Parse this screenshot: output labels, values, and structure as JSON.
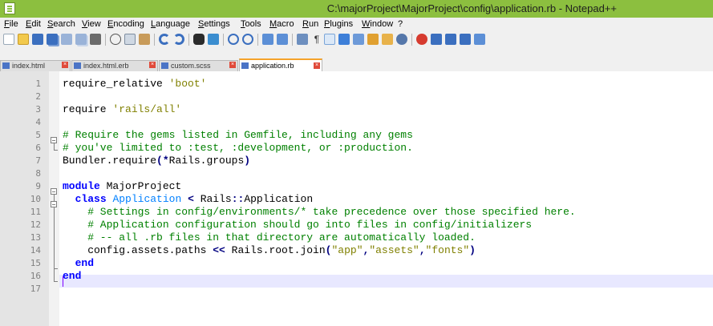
{
  "window": {
    "title": "C:\\majorProject\\MajorProject\\config\\application.rb - Notepad++"
  },
  "menu": [
    "File",
    "Edit",
    "Search",
    "View",
    "Encoding",
    "Language",
    "Settings",
    "Tools",
    "Macro",
    "Run",
    "Plugins",
    "Window",
    "?"
  ],
  "toolbar_icons": [
    "new-file-icon",
    "open-file-icon",
    "save-icon",
    "save-all-icon",
    "close-icon",
    "close-all-icon",
    "print-icon",
    "cut-icon",
    "copy-icon",
    "paste-icon",
    "undo-icon",
    "redo-icon",
    "find-icon",
    "replace-icon",
    "zoom-in-icon",
    "zoom-out-icon",
    "sync-vertical-icon",
    "sync-horizontal-icon",
    "word-wrap-icon",
    "show-all-chars-icon",
    "indent-guide-icon",
    "user-language-icon",
    "doc-map-icon",
    "function-list-icon",
    "folder-workspace-icon",
    "monitor-icon",
    "record-macro-icon",
    "stop-record-icon",
    "play-macro-icon",
    "run-macro-multiple-icon",
    "save-macro-icon"
  ],
  "tabs": [
    {
      "label": "index.html",
      "active": false
    },
    {
      "label": "index.html.erb",
      "active": false
    },
    {
      "label": "custom.scss",
      "active": false
    },
    {
      "label": "application.rb",
      "active": true
    }
  ],
  "editor": {
    "lines": [
      {
        "n": "1",
        "tokens": [
          {
            "t": "require_relative ",
            "c": ""
          },
          {
            "t": "'boot'",
            "c": "str"
          }
        ]
      },
      {
        "n": "2",
        "tokens": []
      },
      {
        "n": "3",
        "tokens": [
          {
            "t": "require ",
            "c": ""
          },
          {
            "t": "'rails/all'",
            "c": "str"
          }
        ]
      },
      {
        "n": "4",
        "tokens": []
      },
      {
        "n": "5",
        "tokens": [
          {
            "t": "# Require the gems listed in Gemfile, including any gems",
            "c": "cm"
          }
        ]
      },
      {
        "n": "6",
        "tokens": [
          {
            "t": "# you've limited to :test, :development, or :production.",
            "c": "cm"
          }
        ]
      },
      {
        "n": "7",
        "tokens": [
          {
            "t": "Bundler.require",
            "c": ""
          },
          {
            "t": "(*",
            "c": "op"
          },
          {
            "t": "Rails.groups",
            "c": ""
          },
          {
            "t": ")",
            "c": "op"
          }
        ]
      },
      {
        "n": "8",
        "tokens": []
      },
      {
        "n": "9",
        "tokens": [
          {
            "t": "module",
            "c": "kw"
          },
          {
            "t": " MajorProject",
            "c": ""
          }
        ]
      },
      {
        "n": "10",
        "tokens": [
          {
            "t": "  ",
            "c": ""
          },
          {
            "t": "class",
            "c": "kw"
          },
          {
            "t": " ",
            "c": ""
          },
          {
            "t": "Application",
            "c": "cls"
          },
          {
            "t": " ",
            "c": ""
          },
          {
            "t": "<",
            "c": "op"
          },
          {
            "t": " Rails",
            "c": ""
          },
          {
            "t": "::",
            "c": "op"
          },
          {
            "t": "Application",
            "c": ""
          }
        ]
      },
      {
        "n": "11",
        "tokens": [
          {
            "t": "    # Settings in config/environments/* take precedence over those specified here.",
            "c": "cm"
          }
        ]
      },
      {
        "n": "12",
        "tokens": [
          {
            "t": "    # Application configuration should go into files in config/initializers",
            "c": "cm"
          }
        ]
      },
      {
        "n": "13",
        "tokens": [
          {
            "t": "    # -- all .rb files in that directory are automatically loaded.",
            "c": "cm"
          }
        ]
      },
      {
        "n": "14",
        "tokens": [
          {
            "t": "    config.assets.paths ",
            "c": ""
          },
          {
            "t": "<<",
            "c": "op"
          },
          {
            "t": " Rails.root.join",
            "c": ""
          },
          {
            "t": "(",
            "c": "op"
          },
          {
            "t": "\"app\"",
            "c": "str"
          },
          {
            "t": ",",
            "c": "op"
          },
          {
            "t": "\"assets\"",
            "c": "str"
          },
          {
            "t": ",",
            "c": "op"
          },
          {
            "t": "\"fonts\"",
            "c": "str"
          },
          {
            "t": ")",
            "c": "op"
          }
        ]
      },
      {
        "n": "15",
        "tokens": [
          {
            "t": "  ",
            "c": ""
          },
          {
            "t": "end",
            "c": "kw"
          }
        ]
      },
      {
        "n": "16",
        "tokens": [
          {
            "t": "end",
            "c": "kw"
          }
        ]
      },
      {
        "n": "17",
        "tokens": []
      }
    ],
    "current_line": "17"
  },
  "colors": {
    "titlebar": "#8cbf3f",
    "keyword": "#0000ff",
    "string": "#808000",
    "comment": "#008000",
    "operator": "#000080",
    "class_name": "#0080ff",
    "active_tab_accent": "#f5a32b"
  }
}
